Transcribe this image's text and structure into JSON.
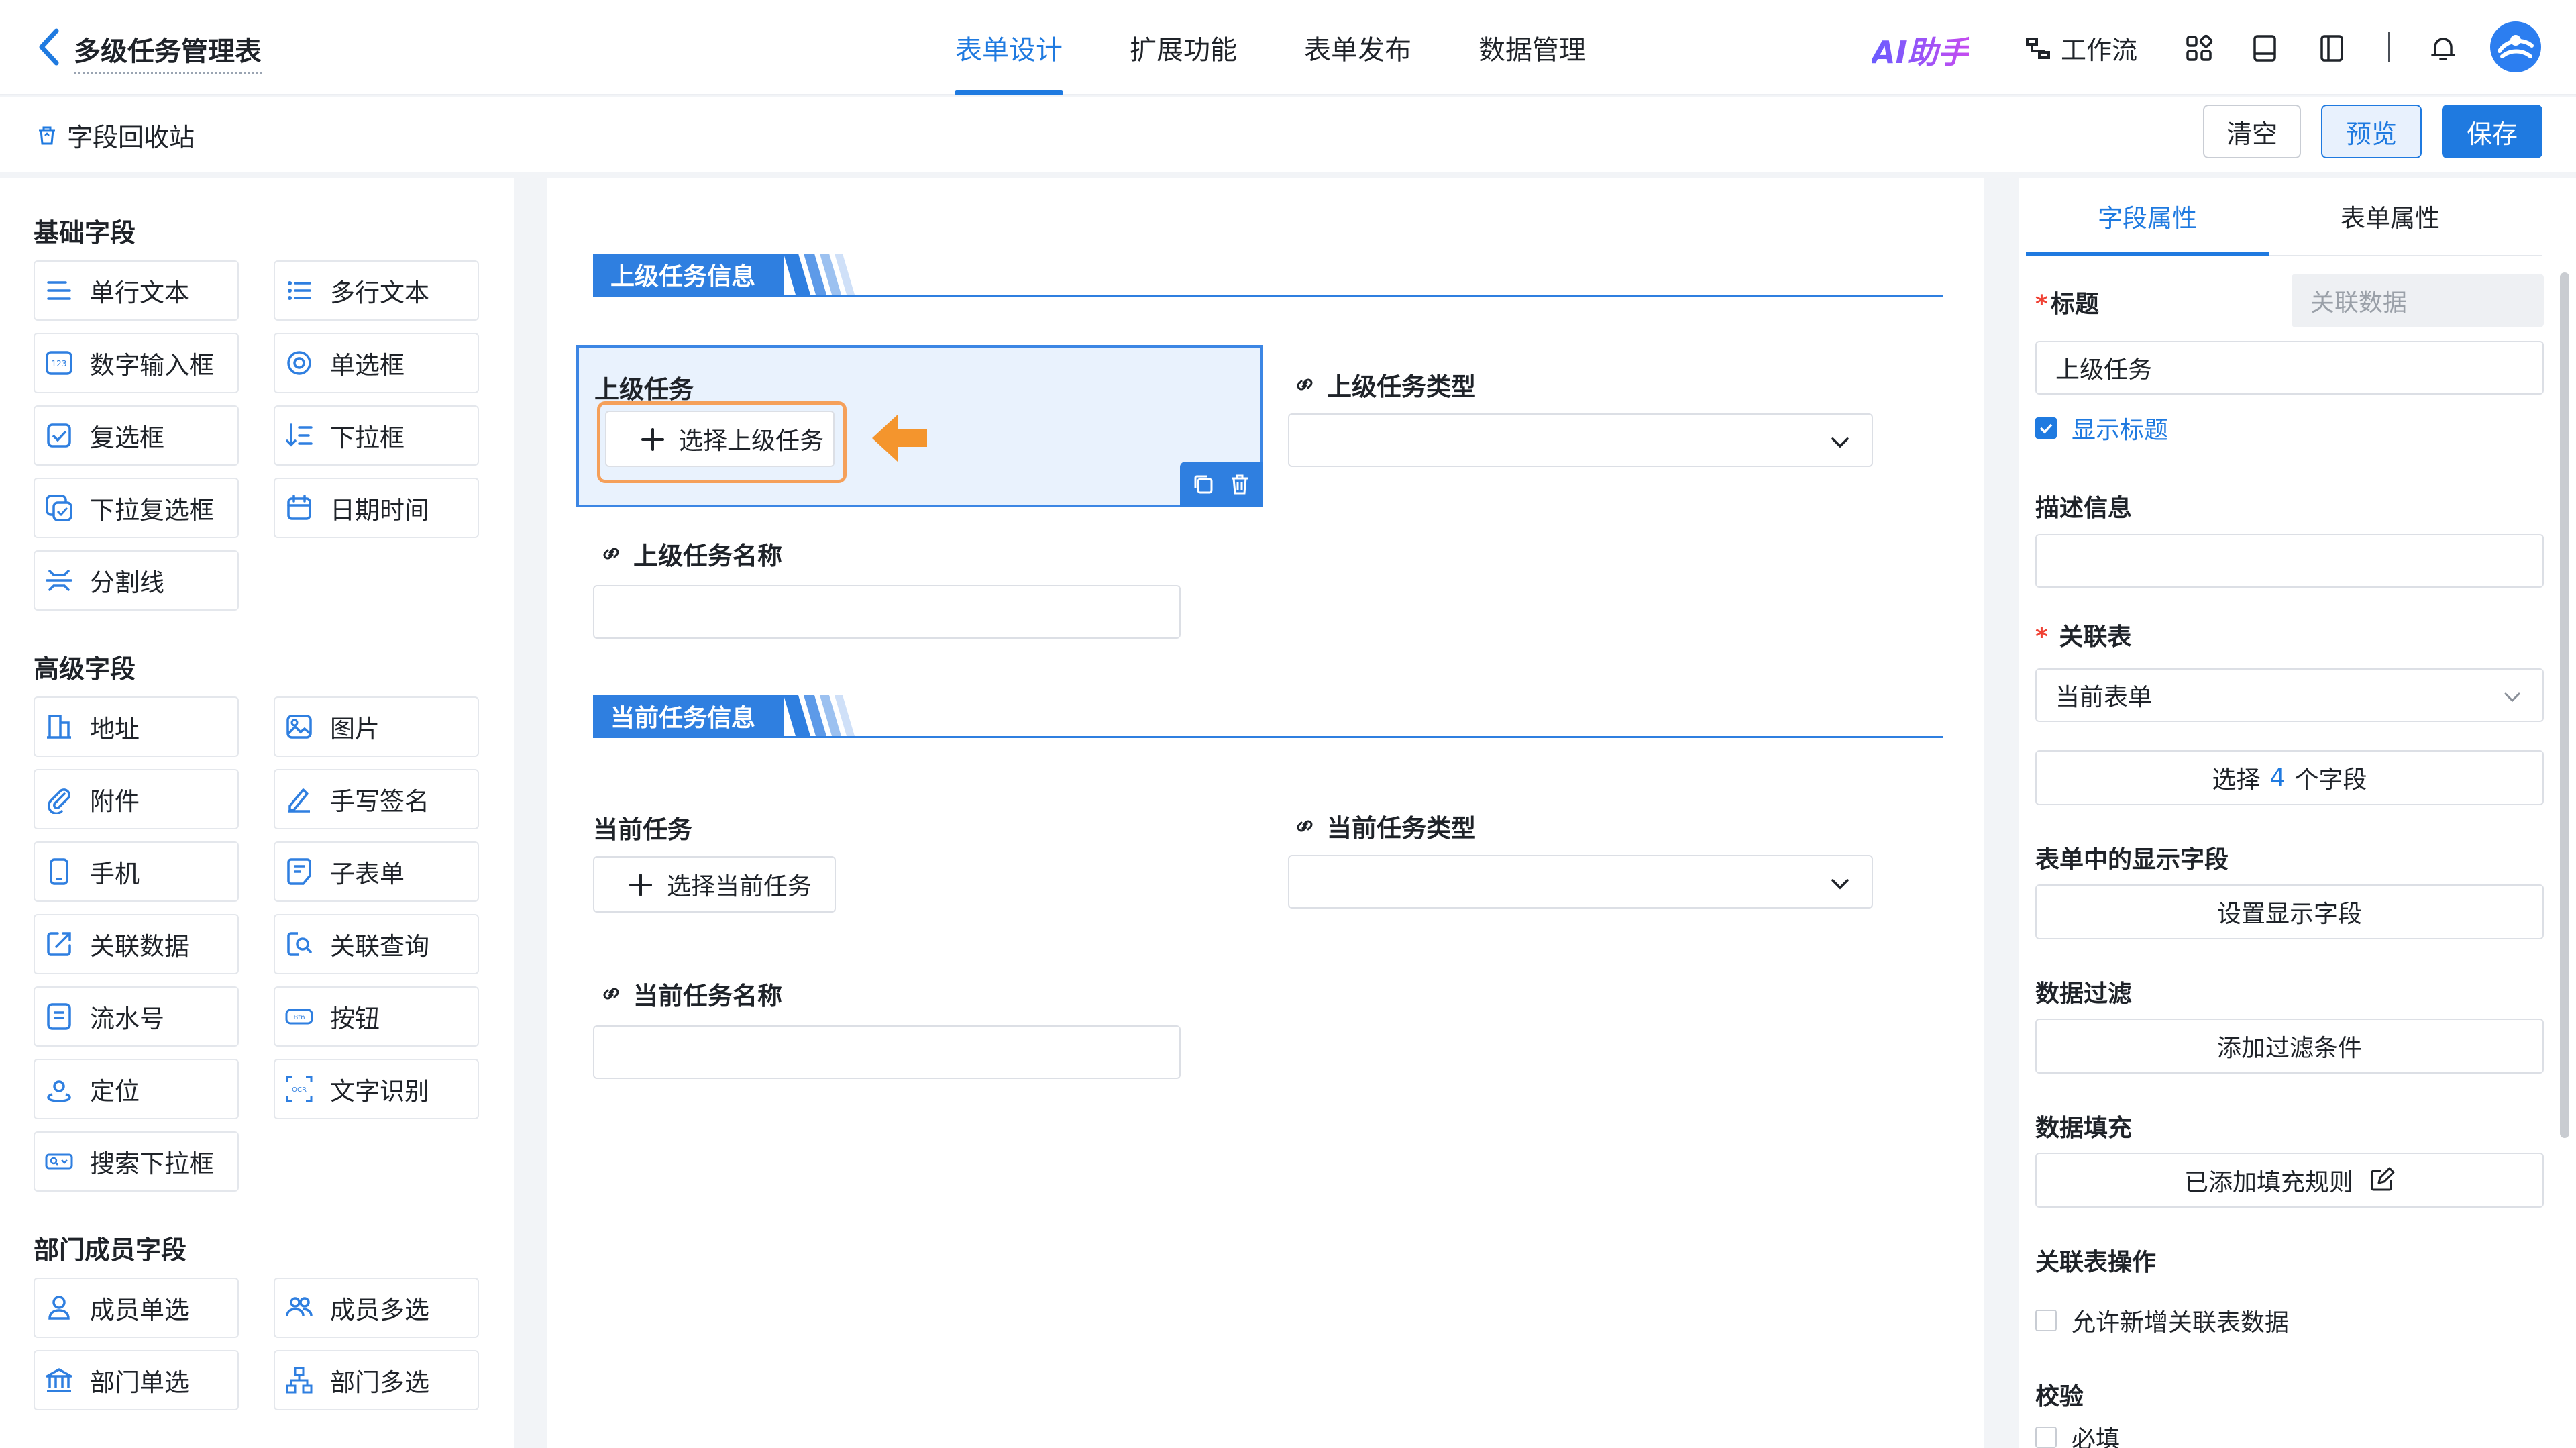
{
  "header": {
    "title": "多级任务管理表",
    "tabs": [
      {
        "label": "表单设计",
        "active": true
      },
      {
        "label": "扩展功能",
        "active": false
      },
      {
        "label": "表单发布",
        "active": false
      },
      {
        "label": "数据管理",
        "active": false
      }
    ],
    "ai_assistant": "AI助手",
    "workflow": "工作流",
    "accent_color": "#1f7ae0"
  },
  "toolbar": {
    "recycle_bin": "字段回收站",
    "clear": "清空",
    "preview": "预览",
    "save": "保存"
  },
  "left_panel": {
    "groups": [
      {
        "title": "基础字段",
        "items": [
          {
            "label": "单行文本",
            "icon": "single-line-text-icon"
          },
          {
            "label": "多行文本",
            "icon": "multi-line-text-icon"
          },
          {
            "label": "数字输入框",
            "icon": "number-input-icon"
          },
          {
            "label": "单选框",
            "icon": "radio-icon"
          },
          {
            "label": "复选框",
            "icon": "checkbox-icon"
          },
          {
            "label": "下拉框",
            "icon": "dropdown-icon"
          },
          {
            "label": "下拉复选框",
            "icon": "dropdown-checkbox-icon"
          },
          {
            "label": "日期时间",
            "icon": "calendar-icon"
          },
          {
            "label": "分割线",
            "icon": "divider-icon"
          }
        ]
      },
      {
        "title": "高级字段",
        "items": [
          {
            "label": "地址",
            "icon": "address-icon"
          },
          {
            "label": "图片",
            "icon": "image-icon"
          },
          {
            "label": "附件",
            "icon": "attachment-icon"
          },
          {
            "label": "手写签名",
            "icon": "signature-icon"
          },
          {
            "label": "手机",
            "icon": "phone-icon"
          },
          {
            "label": "子表单",
            "icon": "subform-icon"
          },
          {
            "label": "关联数据",
            "icon": "linked-data-icon"
          },
          {
            "label": "关联查询",
            "icon": "linked-query-icon"
          },
          {
            "label": "流水号",
            "icon": "serial-number-icon"
          },
          {
            "label": "按钮",
            "icon": "button-icon",
            "badge": "Btn"
          },
          {
            "label": "定位",
            "icon": "location-icon"
          },
          {
            "label": "文字识别",
            "icon": "ocr-icon",
            "badge": "OCR"
          },
          {
            "label": "搜索下拉框",
            "icon": "search-dropdown-icon"
          }
        ]
      },
      {
        "title": "部门成员字段",
        "items": [
          {
            "label": "成员单选",
            "icon": "member-single-icon"
          },
          {
            "label": "成员多选",
            "icon": "member-multi-icon"
          },
          {
            "label": "部门单选",
            "icon": "department-single-icon"
          },
          {
            "label": "部门多选",
            "icon": "department-multi-icon"
          }
        ]
      }
    ]
  },
  "canvas": {
    "section1": {
      "title": "上级任务信息",
      "parent_task": {
        "label": "上级任务",
        "button": "选择上级任务"
      },
      "parent_task_type": {
        "label": "上级任务类型",
        "value": ""
      },
      "parent_task_name": {
        "label": "上级任务名称",
        "value": ""
      }
    },
    "section2": {
      "title": "当前任务信息",
      "current_task": {
        "label": "当前任务",
        "button": "选择当前任务"
      },
      "current_task_type": {
        "label": "当前任务类型",
        "value": ""
      },
      "current_task_name": {
        "label": "当前任务名称",
        "value": ""
      }
    }
  },
  "right_panel": {
    "tabs": [
      {
        "label": "字段属性",
        "active": true
      },
      {
        "label": "表单属性",
        "active": false
      }
    ],
    "title_label": "标题",
    "field_type": "关联数据",
    "title_value": "上级任务",
    "show_title": {
      "label": "显示标题",
      "checked": true
    },
    "description_label": "描述信息",
    "description_value": "",
    "linked_table_label": "关联表",
    "linked_table_value": "当前表单",
    "select_fields": {
      "prefix": "选择",
      "count": "4",
      "suffix": "个字段"
    },
    "display_fields_label": "表单中的显示字段",
    "display_fields_button": "设置显示字段",
    "data_filter_label": "数据过滤",
    "data_filter_button": "添加过滤条件",
    "data_fill_label": "数据填充",
    "data_fill_button": "已添加填充规则",
    "linked_ops_label": "关联表操作",
    "allow_add": {
      "label": "允许新增关联表数据",
      "checked": false
    },
    "validation_label": "校验",
    "required": {
      "label": "必填",
      "checked": false
    }
  }
}
